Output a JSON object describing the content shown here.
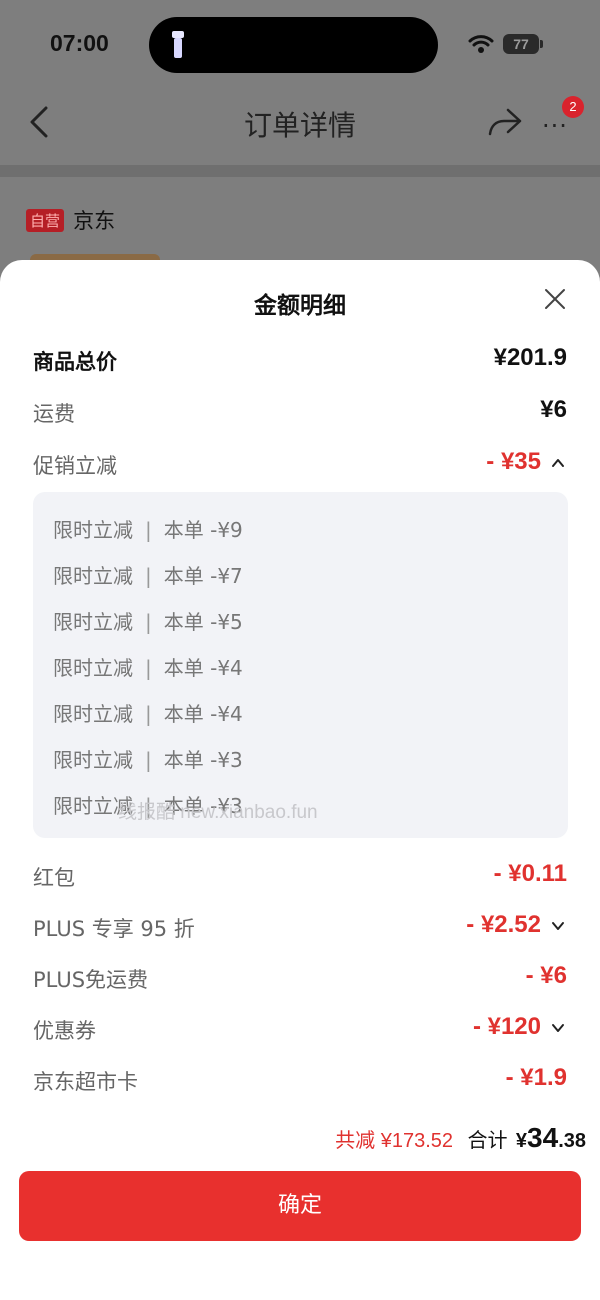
{
  "status_bar": {
    "time": "07:00",
    "battery": "77"
  },
  "nav": {
    "title": "订单详情",
    "more_badge": "2"
  },
  "shop": {
    "self_tag": "自营",
    "name": "京东"
  },
  "sheet": {
    "title": "金额明细",
    "goods_total": {
      "label": "商品总价",
      "amount": "¥201.9"
    },
    "shipping": {
      "label": "运费",
      "amount": "¥6"
    },
    "promo": {
      "label": "促销立减",
      "amount": "- ¥35"
    },
    "promo_items": [
      {
        "name": "限时立减",
        "sep": "|",
        "detail": "本单 -¥9"
      },
      {
        "name": "限时立减",
        "sep": "|",
        "detail": "本单 -¥7"
      },
      {
        "name": "限时立减",
        "sep": "|",
        "detail": "本单 -¥5"
      },
      {
        "name": "限时立减",
        "sep": "|",
        "detail": "本单 -¥4"
      },
      {
        "name": "限时立减",
        "sep": "|",
        "detail": "本单 -¥4"
      },
      {
        "name": "限时立减",
        "sep": "|",
        "detail": "本单 -¥3"
      },
      {
        "name": "限时立减",
        "sep": "|",
        "detail": "本单 -¥3"
      }
    ],
    "watermark": "线报酷 new.xianbao.fun",
    "red_packet": {
      "label": "红包",
      "amount": "- ¥0.11"
    },
    "plus_discount": {
      "label": "PLUS 专享 95 折",
      "amount": "- ¥2.52"
    },
    "plus_shipping": {
      "label": "PLUS免运费",
      "amount": "- ¥6"
    },
    "coupon": {
      "label": "优惠券",
      "amount": "- ¥120"
    },
    "supermarket_card": {
      "label": "京东超市卡",
      "amount": "- ¥1.9"
    },
    "summary": {
      "saved": "共减 ¥173.52",
      "total_label": "合计",
      "yen": "¥",
      "total_int": "34",
      "total_dec": ".38"
    },
    "confirm_label": "确定"
  },
  "colors": {
    "accent_red": "#e8302e",
    "price_red": "#e0322f"
  }
}
